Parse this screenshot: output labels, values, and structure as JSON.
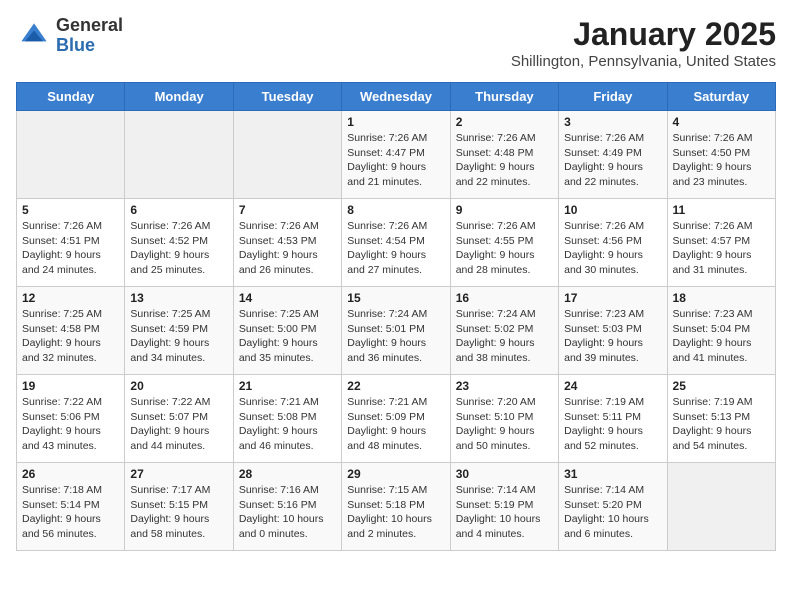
{
  "header": {
    "logo_general": "General",
    "logo_blue": "Blue",
    "month": "January 2025",
    "location": "Shillington, Pennsylvania, United States"
  },
  "weekdays": [
    "Sunday",
    "Monday",
    "Tuesday",
    "Wednesday",
    "Thursday",
    "Friday",
    "Saturday"
  ],
  "weeks": [
    [
      {
        "day": null
      },
      {
        "day": null
      },
      {
        "day": null
      },
      {
        "day": 1,
        "sunrise": "Sunrise: 7:26 AM",
        "sunset": "Sunset: 4:47 PM",
        "daylight": "Daylight: 9 hours and 21 minutes."
      },
      {
        "day": 2,
        "sunrise": "Sunrise: 7:26 AM",
        "sunset": "Sunset: 4:48 PM",
        "daylight": "Daylight: 9 hours and 22 minutes."
      },
      {
        "day": 3,
        "sunrise": "Sunrise: 7:26 AM",
        "sunset": "Sunset: 4:49 PM",
        "daylight": "Daylight: 9 hours and 22 minutes."
      },
      {
        "day": 4,
        "sunrise": "Sunrise: 7:26 AM",
        "sunset": "Sunset: 4:50 PM",
        "daylight": "Daylight: 9 hours and 23 minutes."
      }
    ],
    [
      {
        "day": 5,
        "sunrise": "Sunrise: 7:26 AM",
        "sunset": "Sunset: 4:51 PM",
        "daylight": "Daylight: 9 hours and 24 minutes."
      },
      {
        "day": 6,
        "sunrise": "Sunrise: 7:26 AM",
        "sunset": "Sunset: 4:52 PM",
        "daylight": "Daylight: 9 hours and 25 minutes."
      },
      {
        "day": 7,
        "sunrise": "Sunrise: 7:26 AM",
        "sunset": "Sunset: 4:53 PM",
        "daylight": "Daylight: 9 hours and 26 minutes."
      },
      {
        "day": 8,
        "sunrise": "Sunrise: 7:26 AM",
        "sunset": "Sunset: 4:54 PM",
        "daylight": "Daylight: 9 hours and 27 minutes."
      },
      {
        "day": 9,
        "sunrise": "Sunrise: 7:26 AM",
        "sunset": "Sunset: 4:55 PM",
        "daylight": "Daylight: 9 hours and 28 minutes."
      },
      {
        "day": 10,
        "sunrise": "Sunrise: 7:26 AM",
        "sunset": "Sunset: 4:56 PM",
        "daylight": "Daylight: 9 hours and 30 minutes."
      },
      {
        "day": 11,
        "sunrise": "Sunrise: 7:26 AM",
        "sunset": "Sunset: 4:57 PM",
        "daylight": "Daylight: 9 hours and 31 minutes."
      }
    ],
    [
      {
        "day": 12,
        "sunrise": "Sunrise: 7:25 AM",
        "sunset": "Sunset: 4:58 PM",
        "daylight": "Daylight: 9 hours and 32 minutes."
      },
      {
        "day": 13,
        "sunrise": "Sunrise: 7:25 AM",
        "sunset": "Sunset: 4:59 PM",
        "daylight": "Daylight: 9 hours and 34 minutes."
      },
      {
        "day": 14,
        "sunrise": "Sunrise: 7:25 AM",
        "sunset": "Sunset: 5:00 PM",
        "daylight": "Daylight: 9 hours and 35 minutes."
      },
      {
        "day": 15,
        "sunrise": "Sunrise: 7:24 AM",
        "sunset": "Sunset: 5:01 PM",
        "daylight": "Daylight: 9 hours and 36 minutes."
      },
      {
        "day": 16,
        "sunrise": "Sunrise: 7:24 AM",
        "sunset": "Sunset: 5:02 PM",
        "daylight": "Daylight: 9 hours and 38 minutes."
      },
      {
        "day": 17,
        "sunrise": "Sunrise: 7:23 AM",
        "sunset": "Sunset: 5:03 PM",
        "daylight": "Daylight: 9 hours and 39 minutes."
      },
      {
        "day": 18,
        "sunrise": "Sunrise: 7:23 AM",
        "sunset": "Sunset: 5:04 PM",
        "daylight": "Daylight: 9 hours and 41 minutes."
      }
    ],
    [
      {
        "day": 19,
        "sunrise": "Sunrise: 7:22 AM",
        "sunset": "Sunset: 5:06 PM",
        "daylight": "Daylight: 9 hours and 43 minutes."
      },
      {
        "day": 20,
        "sunrise": "Sunrise: 7:22 AM",
        "sunset": "Sunset: 5:07 PM",
        "daylight": "Daylight: 9 hours and 44 minutes."
      },
      {
        "day": 21,
        "sunrise": "Sunrise: 7:21 AM",
        "sunset": "Sunset: 5:08 PM",
        "daylight": "Daylight: 9 hours and 46 minutes."
      },
      {
        "day": 22,
        "sunrise": "Sunrise: 7:21 AM",
        "sunset": "Sunset: 5:09 PM",
        "daylight": "Daylight: 9 hours and 48 minutes."
      },
      {
        "day": 23,
        "sunrise": "Sunrise: 7:20 AM",
        "sunset": "Sunset: 5:10 PM",
        "daylight": "Daylight: 9 hours and 50 minutes."
      },
      {
        "day": 24,
        "sunrise": "Sunrise: 7:19 AM",
        "sunset": "Sunset: 5:11 PM",
        "daylight": "Daylight: 9 hours and 52 minutes."
      },
      {
        "day": 25,
        "sunrise": "Sunrise: 7:19 AM",
        "sunset": "Sunset: 5:13 PM",
        "daylight": "Daylight: 9 hours and 54 minutes."
      }
    ],
    [
      {
        "day": 26,
        "sunrise": "Sunrise: 7:18 AM",
        "sunset": "Sunset: 5:14 PM",
        "daylight": "Daylight: 9 hours and 56 minutes."
      },
      {
        "day": 27,
        "sunrise": "Sunrise: 7:17 AM",
        "sunset": "Sunset: 5:15 PM",
        "daylight": "Daylight: 9 hours and 58 minutes."
      },
      {
        "day": 28,
        "sunrise": "Sunrise: 7:16 AM",
        "sunset": "Sunset: 5:16 PM",
        "daylight": "Daylight: 10 hours and 0 minutes."
      },
      {
        "day": 29,
        "sunrise": "Sunrise: 7:15 AM",
        "sunset": "Sunset: 5:18 PM",
        "daylight": "Daylight: 10 hours and 2 minutes."
      },
      {
        "day": 30,
        "sunrise": "Sunrise: 7:14 AM",
        "sunset": "Sunset: 5:19 PM",
        "daylight": "Daylight: 10 hours and 4 minutes."
      },
      {
        "day": 31,
        "sunrise": "Sunrise: 7:14 AM",
        "sunset": "Sunset: 5:20 PM",
        "daylight": "Daylight: 10 hours and 6 minutes."
      },
      {
        "day": null
      }
    ]
  ]
}
